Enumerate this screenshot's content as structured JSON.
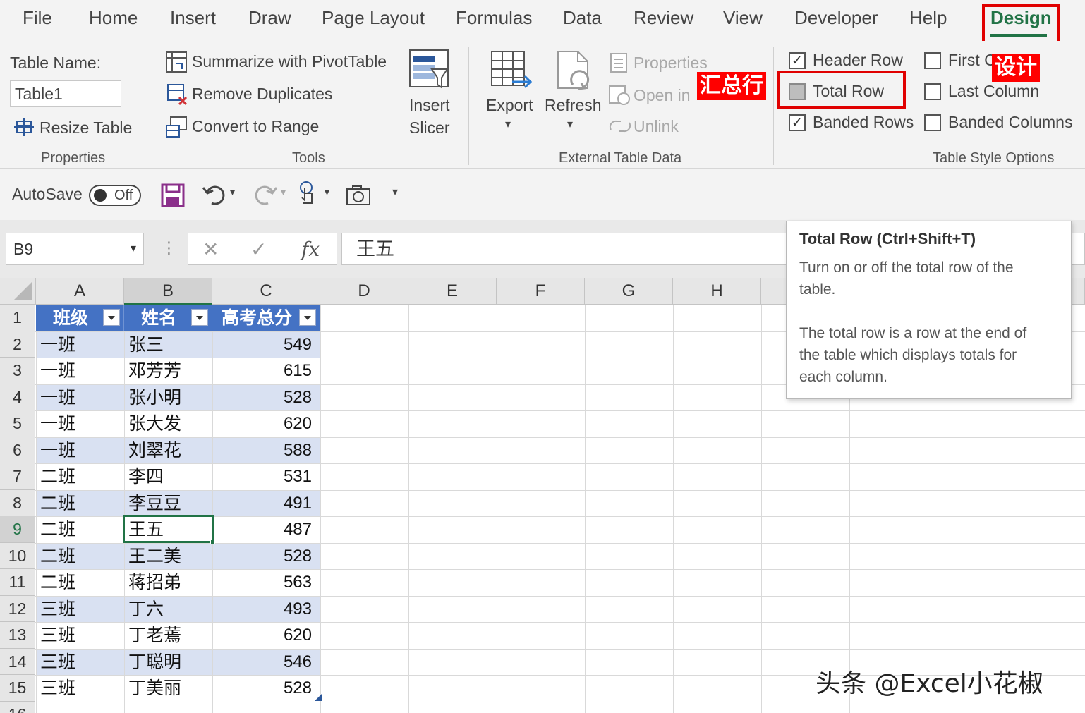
{
  "ribbon_tabs": [
    "File",
    "Home",
    "Insert",
    "Draw",
    "Page Layout",
    "Formulas",
    "Data",
    "Review",
    "View",
    "Developer",
    "Help",
    "Design"
  ],
  "annotations": {
    "design_cn": "设计",
    "total_row_cn": "汇总行"
  },
  "properties_group": {
    "table_name_label": "Table Name:",
    "table_name_value": "Table1",
    "resize_table": "Resize Table",
    "group_label": "Properties"
  },
  "tools_group": {
    "summarize": "Summarize with PivotTable",
    "remove_duplicates": "Remove Duplicates",
    "convert_to_range": "Convert to Range",
    "insert_slicer_1": "Insert",
    "insert_slicer_2": "Slicer",
    "group_label": "Tools"
  },
  "external_group": {
    "export": "Export",
    "refresh": "Refresh",
    "properties": "Properties",
    "open_in_browser": "Open in",
    "unlink": "Unlink",
    "group_label": "External Table Data"
  },
  "style_options": {
    "header_row": "Header Row",
    "total_row": "Total Row",
    "banded_rows": "Banded Rows",
    "first_column": "First C",
    "last_column": "Last Column",
    "banded_columns": "Banded Columns",
    "group_label": "Table Style Options",
    "header_row_checked": true,
    "total_row_checked": false,
    "banded_rows_checked": true,
    "first_column_checked": false,
    "last_column_checked": false,
    "banded_columns_checked": false
  },
  "qat": {
    "autosave": "AutoSave",
    "autosave_state": "Off"
  },
  "formula_bar": {
    "name_box": "B9",
    "fx": "fx",
    "formula": "王五"
  },
  "grid": {
    "columns": [
      "A",
      "B",
      "C",
      "D",
      "E",
      "F",
      "G",
      "H"
    ],
    "selected_column": "B",
    "selected_row": 9,
    "rows": [
      1,
      2,
      3,
      4,
      5,
      6,
      7,
      8,
      9,
      10,
      11,
      12,
      13,
      14,
      15,
      16
    ],
    "headers": [
      "班级",
      "姓名",
      "高考总分"
    ],
    "data": [
      [
        "一班",
        "张三",
        "549"
      ],
      [
        "一班",
        "邓芳芳",
        "615"
      ],
      [
        "一班",
        "张小明",
        "528"
      ],
      [
        "一班",
        "张大发",
        "620"
      ],
      [
        "一班",
        "刘翠花",
        "588"
      ],
      [
        "二班",
        "李四",
        "531"
      ],
      [
        "二班",
        "李豆豆",
        "491"
      ],
      [
        "二班",
        "王五",
        "487"
      ],
      [
        "二班",
        "王二美",
        "528"
      ],
      [
        "二班",
        "蒋招弟",
        "563"
      ],
      [
        "三班",
        "丁六",
        "493"
      ],
      [
        "三班",
        "丁老蔫",
        "620"
      ],
      [
        "三班",
        "丁聪明",
        "546"
      ],
      [
        "三班",
        "丁美丽",
        "528"
      ]
    ]
  },
  "tooltip": {
    "title": "Total Row (Ctrl+Shift+T)",
    "line1": "Turn on or off the total row of the",
    "line2": "table.",
    "line3": "The total row is a row at the end of",
    "line4": "the table which displays totals for",
    "line5": "each column."
  },
  "watermark": "头条 @Excel小花椒",
  "colors": {
    "accent": "#217346",
    "table_header": "#4472c4",
    "band": "#d9e1f2",
    "highlight": "#ff0000"
  }
}
